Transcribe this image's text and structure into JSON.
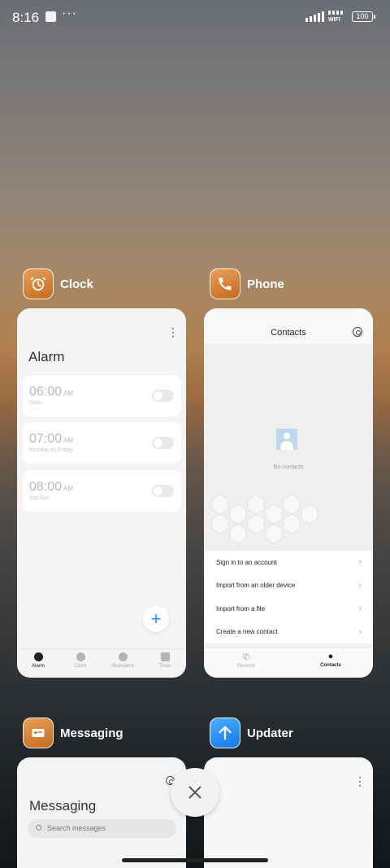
{
  "status_bar": {
    "time": "8:16",
    "more": "···",
    "wifi_label": "WIFI",
    "battery": "100"
  },
  "apps": {
    "clock": {
      "name": "Clock",
      "screen_title": "Alarm",
      "alarms": [
        {
          "time": "06:00",
          "ampm": "AM",
          "repeat": "Daily"
        },
        {
          "time": "07:00",
          "ampm": "AM",
          "repeat": "Monday to Friday"
        },
        {
          "time": "08:00",
          "ampm": "AM",
          "repeat": "Sat Sun"
        }
      ],
      "tabs": [
        "Alarm",
        "Clock",
        "Stopwatch",
        "Timer"
      ],
      "active_tab": "Alarm"
    },
    "phone": {
      "name": "Phone",
      "screen_title": "Contacts",
      "empty_text": "No contacts",
      "menu": [
        "Sign in to an account",
        "Import from an older device",
        "Import from a file",
        "Create a new contact"
      ],
      "tabs": [
        "Recents",
        "Contacts"
      ],
      "active_tab": "Contacts"
    },
    "messaging": {
      "name": "Messaging",
      "screen_title": "Messaging",
      "search_placeholder": "Search messages"
    },
    "updater": {
      "name": "Updater"
    }
  },
  "icons": {
    "clock": "alarm-clock-icon",
    "phone": "phone-handset-icon",
    "messaging": "message-icon",
    "updater": "arrow-up-icon",
    "close": "close-icon"
  },
  "colors": {
    "accent_blue": "#2a8cff",
    "app_icon_orange": "#d98a3f",
    "updater_blue": "#1f8bf5"
  }
}
